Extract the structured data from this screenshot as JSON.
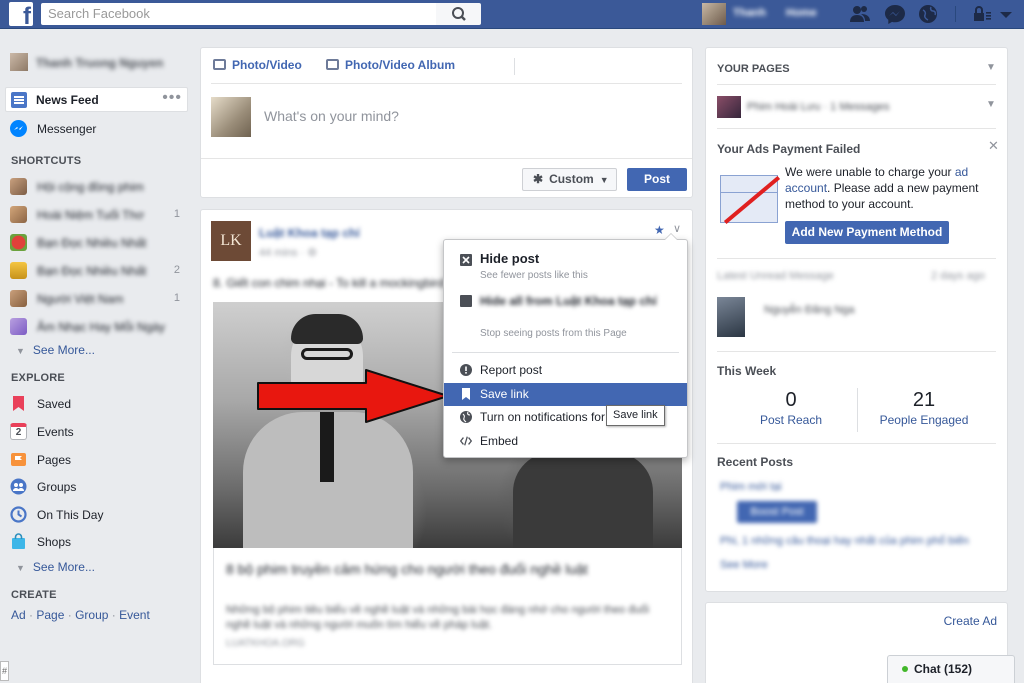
{
  "topbar": {
    "logo": "f",
    "search_placeholder": "Search Facebook",
    "user_name": "Thanh",
    "home_label": "Home",
    "icons": [
      "friend-requests-icon",
      "messages-icon",
      "notifications-icon",
      "privacy-shortcuts-icon",
      "account-menu-icon"
    ]
  },
  "left_sidebar": {
    "profile_name": "Thanh Truong Nguyen",
    "news_feed": "News Feed",
    "news_feed_more": "•••",
    "messenger": "Messenger",
    "shortcuts_header": "SHORTCUTS",
    "shortcuts": [
      {
        "label": "Hội cộng đồng phim",
        "count": ""
      },
      {
        "label": "Hoài Niệm Tuổi Thơ",
        "count": "1"
      },
      {
        "label": "Bạn Đọc Nhiều Nhất",
        "count": ""
      },
      {
        "label": "Bạn Đọc Nhiều Nhất",
        "count": "2"
      },
      {
        "label": "Người Việt Nam",
        "count": "1"
      },
      {
        "label": "Âm Nhạc Hay Mỗi Ngày",
        "count": ""
      }
    ],
    "see_more_1": "See More...",
    "explore_header": "EXPLORE",
    "explore": [
      {
        "label": "Saved",
        "icon": "bookmark-icon",
        "color": "#e9405a"
      },
      {
        "label": "Events",
        "icon": "calendar-icon",
        "color": "#f5f6f7"
      },
      {
        "label": "Pages",
        "icon": "flag-icon",
        "color": "#f7923b"
      },
      {
        "label": "Groups",
        "icon": "groups-icon",
        "color": "#4a76c7"
      },
      {
        "label": "On This Day",
        "icon": "clock-icon",
        "color": "#4a76c7"
      },
      {
        "label": "Shops",
        "icon": "shopping-bag-icon",
        "color": "#3db6e8"
      }
    ],
    "events_day": "2",
    "see_more_2": "See More...",
    "create_header": "CREATE",
    "create_links": [
      "Ad",
      "Page",
      "Group",
      "Event"
    ]
  },
  "composer": {
    "tab_photo": "Photo/Video",
    "tab_album": "Photo/Video Album",
    "placeholder": "What's on your mind?",
    "audience": "Custom",
    "post_button": "Post"
  },
  "feed_post": {
    "avatar_text": "LK",
    "page_name": "Luật Khoa tạp chí",
    "meta": "44 mins · ⚙",
    "text": "8. Giết con chim nhại - To kill a mockingbird",
    "link_title": "8 bộ phim truyền cảm hứng cho người theo đuổi nghề luật",
    "link_desc": "Những bộ phim tiêu biểu về nghề luật và những bài học đáng nhớ cho người theo đuổi nghề luật và những người muốn tìm hiểu về pháp luật.",
    "link_source": "LUATKHOA.ORG"
  },
  "post_menu": {
    "hide_title": "Hide post",
    "hide_sub": "See fewer posts like this",
    "hideall_title": "Hide all from Luật Khoa tạp chí",
    "hideall_sub": "Stop seeing posts from this Page",
    "report": "Report post",
    "save": "Save link",
    "notifications": "Turn on notifications for this post",
    "embed": "Embed",
    "tooltip": "Save link"
  },
  "right_column": {
    "your_pages": "YOUR PAGES",
    "page_name": "Phim Hoài Lưu · 1 Messages",
    "ads_title": "Your Ads Payment Failed",
    "ads_text_1": "We were unable to charge your ",
    "ads_link": "ad account",
    "ads_text_2": ". Please add a new payment method to your account.",
    "ads_button": "Add New Payment Method",
    "latest_msg": "Latest Unread Message",
    "latest_time": "2 days ago",
    "msg_sender": "Nguyễn Đăng Nga",
    "this_week": "This Week",
    "post_reach_value": "0",
    "post_reach_label": "Post Reach",
    "engaged_value": "21",
    "engaged_label": "People Engaged",
    "recent_posts": "Recent Posts",
    "recent_1": "Phim mới tại",
    "boost": "Boost Post",
    "recent_2": "Phi, 1 những câu thoại hay nhất của phim phổ biến",
    "see_more": "See More",
    "create_ad": "Create Ad"
  },
  "chat": {
    "label": "Chat (152)"
  },
  "colors": {
    "brand": "#3b5998",
    "accent": "#4267b2",
    "highlight_arrow": "#e8170f"
  }
}
